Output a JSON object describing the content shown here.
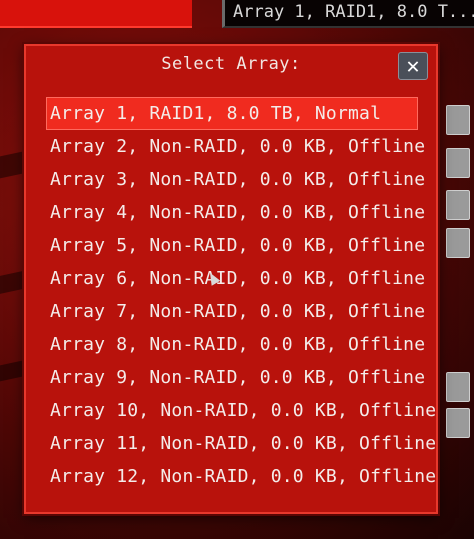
{
  "background": {
    "top_field_text": "Array 1, RAID1, 8.0 T...",
    "accent_color": "#d8120c"
  },
  "dialog": {
    "title": "Select Array:",
    "close_glyph": "✕",
    "selected_index": 0,
    "arrays": [
      {
        "label": "Array 1, RAID1, 8.0 TB, Normal"
      },
      {
        "label": "Array 2, Non-RAID, 0.0 KB, Offline"
      },
      {
        "label": "Array 3, Non-RAID, 0.0 KB, Offline"
      },
      {
        "label": "Array 4, Non-RAID, 0.0 KB, Offline"
      },
      {
        "label": "Array 5, Non-RAID, 0.0 KB, Offline"
      },
      {
        "label": "Array 6, Non-RAID, 0.0 KB, Offline"
      },
      {
        "label": "Array 7, Non-RAID, 0.0 KB, Offline"
      },
      {
        "label": "Array 8, Non-RAID, 0.0 KB, Offline"
      },
      {
        "label": "Array 9, Non-RAID, 0.0 KB, Offline"
      },
      {
        "label": "Array 10, Non-RAID, 0.0 KB, Offline"
      },
      {
        "label": "Array 11, Non-RAID, 0.0 KB, Offline"
      },
      {
        "label": "Array 12, Non-RAID, 0.0 KB, Offline"
      }
    ]
  }
}
